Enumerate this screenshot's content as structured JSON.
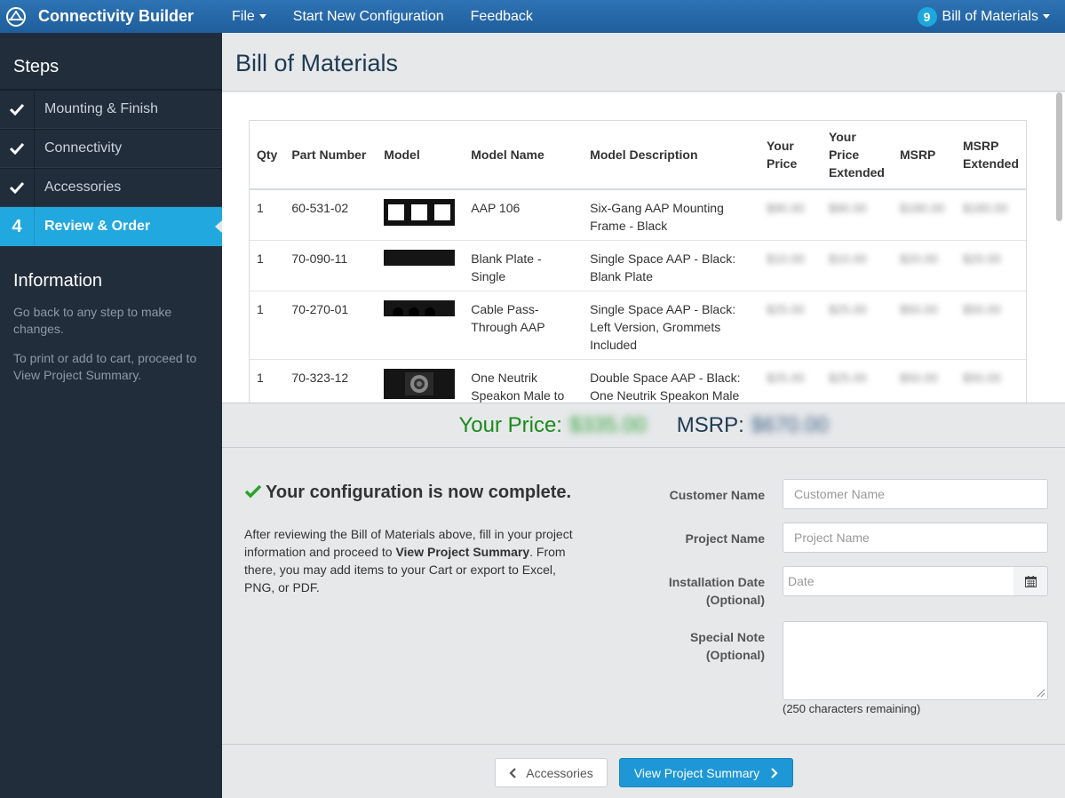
{
  "navbar": {
    "app_title": "Connectivity Builder",
    "file_label": "File",
    "start_new_label": "Start New Configuration",
    "feedback_label": "Feedback",
    "bom_count": "9",
    "bom_label": "Bill of Materials",
    "bar_color": "#2e73b4"
  },
  "sidebar": {
    "steps_title": "Steps",
    "steps": [
      {
        "mark": "check-icon",
        "label": "Mounting & Finish"
      },
      {
        "mark": "check-icon",
        "label": "Connectivity"
      },
      {
        "mark": "check-icon",
        "label": "Accessories"
      },
      {
        "number": "4",
        "label": "Review & Order"
      }
    ],
    "info_title": "Information",
    "info_lines": [
      "Go back to any step to make changes.",
      "To print or add to cart, proceed to View Project Summary."
    ],
    "active_color": "#21a8df"
  },
  "main": {
    "page_title": "Bill of Materials",
    "table": {
      "headers": {
        "qty": "Qty",
        "part": "Part Number",
        "model": "Model",
        "model_name": "Model Name",
        "model_desc": "Model Description",
        "your_price": "Your Price",
        "your_price_ext": "Your Price Extended",
        "msrp": "MSRP",
        "msrp_ext": "MSRP Extended"
      },
      "rows": [
        {
          "qty": "1",
          "part": "60-531-02",
          "model_icon": "mounting-frame-thumbnail",
          "name": "AAP 106",
          "desc": "Six-Gang AAP Mounting Frame - Black",
          "your_price": "$90.00",
          "your_price_ext": "$90.00",
          "msrp": "$180.00",
          "msrp_ext": "$180.00"
        },
        {
          "qty": "1",
          "part": "70-090-11",
          "model_icon": "blank-plate-thumbnail",
          "name": "Blank Plate - Single",
          "desc": "Single Space AAP - Black: Blank Plate",
          "your_price": "$10.00",
          "your_price_ext": "$10.00",
          "msrp": "$20.00",
          "msrp_ext": "$20.00"
        },
        {
          "qty": "1",
          "part": "70-270-01",
          "model_icon": "pass-through-thumbnail",
          "name": "Cable Pass-Through AAP",
          "desc": "Single Space AAP - Black: Left Version, Grommets Included",
          "your_price": "$25.00",
          "your_price_ext": "$25.00",
          "msrp": "$50.00",
          "msrp_ext": "$50.00"
        },
        {
          "qty": "1",
          "part": "70-323-12",
          "model_icon": "speakon-thumbnail",
          "name": "One Neutrik Speakon Male to",
          "desc": "Double Space AAP - Black: One Neutrik Speakon Male",
          "your_price": "$25.00",
          "your_price_ext": "$25.00",
          "msrp": "$50.00",
          "msrp_ext": "$50.00"
        }
      ]
    },
    "totals": {
      "your_price_label": "Your Price:",
      "your_price_value": "$335.00",
      "msrp_label": "MSRP:",
      "msrp_value": "$670.00"
    },
    "complete": {
      "heading": "Your configuration is now complete.",
      "text_1": "After reviewing the Bill of Materials above, fill in your project information and proceed to ",
      "text_bold_1": "View Project Summary",
      "text_2": ". From there, you may add items to your Cart or export to Excel, PNG, or PDF."
    },
    "form": {
      "customer_label": "Customer Name",
      "customer_placeholder": "Customer Name",
      "project_label": "Project Name",
      "project_placeholder": "Project Name",
      "date_label": "Installation Date (Optional)",
      "date_placeholder": "Date",
      "note_label": "Special Note (Optional)",
      "remaining": "(250 characters remaining)"
    },
    "buttons": {
      "back_label": "Accessories",
      "next_label": "View Project Summary"
    }
  }
}
